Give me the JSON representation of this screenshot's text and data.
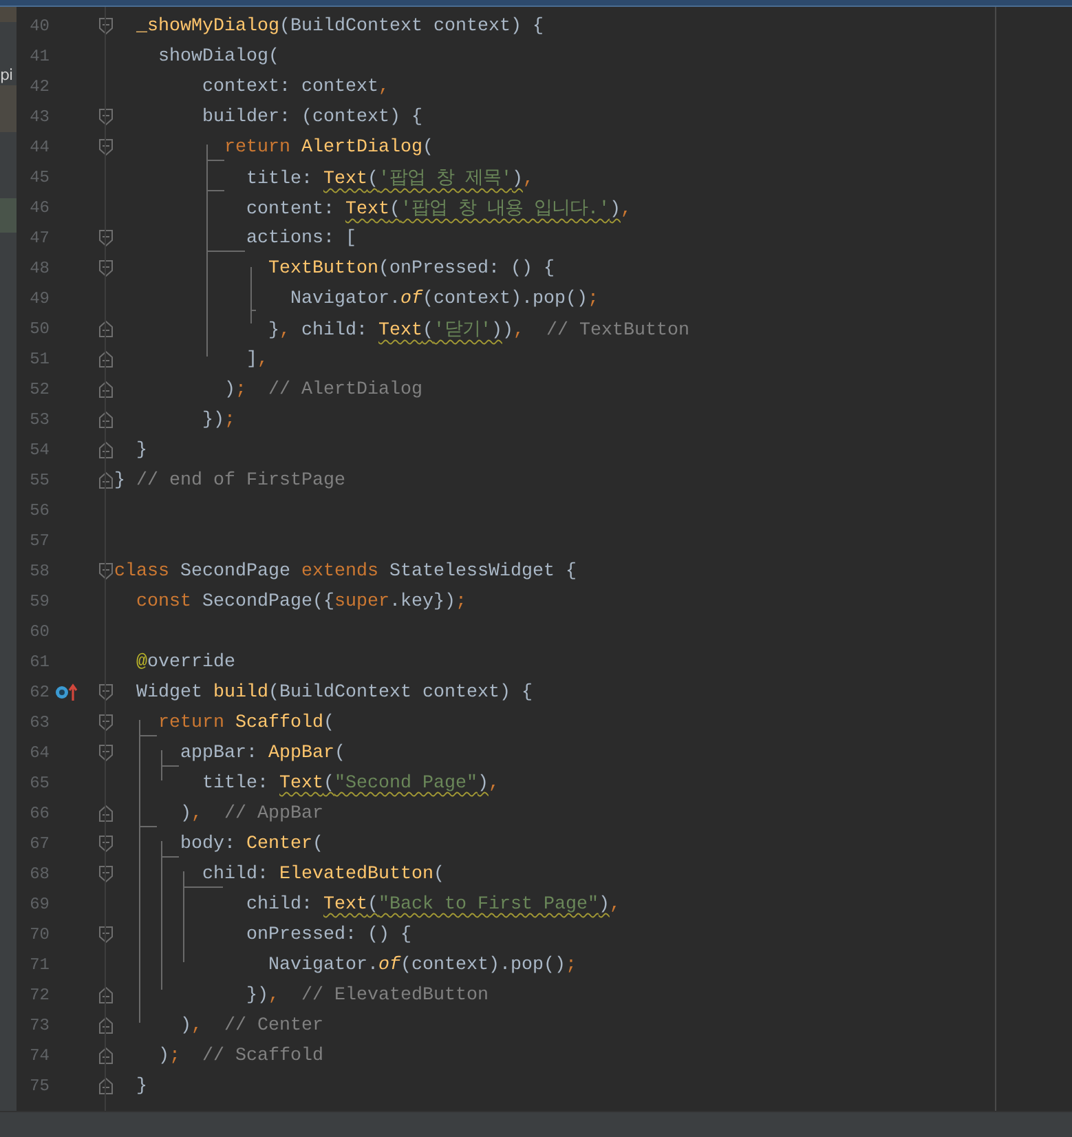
{
  "project_panel": {
    "fragment": "pi"
  },
  "editor": {
    "lines": [
      {
        "number": "40",
        "fold_start": true,
        "fold_end": false,
        "tokens": [
          {
            "text": "  _showMyDialog",
            "kind": "call"
          },
          {
            "text": "(BuildContext context) {",
            "kind": "plain"
          }
        ]
      },
      {
        "number": "41",
        "fold_start": false,
        "fold_end": false,
        "tokens": [
          {
            "text": "    showDialog(",
            "kind": "plain"
          }
        ]
      },
      {
        "number": "42",
        "fold_start": false,
        "fold_end": false,
        "tokens": [
          {
            "text": "        context: context",
            "kind": "plain"
          },
          {
            "text": ",",
            "kind": "punct"
          }
        ]
      },
      {
        "number": "43",
        "fold_start": true,
        "fold_end": false,
        "tokens": [
          {
            "text": "        builder: (context) {",
            "kind": "plain"
          }
        ]
      },
      {
        "number": "44",
        "fold_start": true,
        "fold_end": false,
        "tokens": [
          {
            "text": "          return",
            "kind": "kw"
          },
          {
            "text": " AlertDialog",
            "kind": "call"
          },
          {
            "text": "(",
            "kind": "plain"
          }
        ]
      },
      {
        "number": "45",
        "fold_start": false,
        "fold_end": false,
        "tokens": [
          {
            "text": "            title: ",
            "kind": "plain"
          },
          {
            "text": "Text",
            "kind": "call",
            "warn": true
          },
          {
            "text": "(",
            "kind": "plain",
            "warn": true
          },
          {
            "text": "'팝업 창 제목'",
            "kind": "str",
            "warn": true
          },
          {
            "text": ")",
            "kind": "plain",
            "warn": true
          },
          {
            "text": ",",
            "kind": "punct"
          }
        ]
      },
      {
        "number": "46",
        "fold_start": false,
        "fold_end": false,
        "tokens": [
          {
            "text": "            content: ",
            "kind": "plain"
          },
          {
            "text": "Text",
            "kind": "call",
            "warn": true
          },
          {
            "text": "(",
            "kind": "plain",
            "warn": true
          },
          {
            "text": "'팝업 창 내용 입니다.'",
            "kind": "str",
            "warn": true
          },
          {
            "text": ")",
            "kind": "plain",
            "warn": true
          },
          {
            "text": ",",
            "kind": "punct"
          }
        ]
      },
      {
        "number": "47",
        "fold_start": true,
        "fold_end": false,
        "tokens": [
          {
            "text": "            actions: [",
            "kind": "plain"
          }
        ]
      },
      {
        "number": "48",
        "fold_start": true,
        "fold_end": false,
        "tokens": [
          {
            "text": "              TextButton",
            "kind": "call"
          },
          {
            "text": "(onPressed: () {",
            "kind": "plain"
          }
        ]
      },
      {
        "number": "49",
        "fold_start": false,
        "fold_end": false,
        "tokens": [
          {
            "text": "                Navigator.",
            "kind": "plain"
          },
          {
            "text": "of",
            "kind": "italic"
          },
          {
            "text": "(context).pop()",
            "kind": "plain"
          },
          {
            "text": ";",
            "kind": "punct"
          }
        ]
      },
      {
        "number": "50",
        "fold_start": false,
        "fold_end": true,
        "tokens": [
          {
            "text": "              }",
            "kind": "plain"
          },
          {
            "text": ",",
            "kind": "punct"
          },
          {
            "text": " child: ",
            "kind": "plain"
          },
          {
            "text": "Text",
            "kind": "call",
            "warn": true
          },
          {
            "text": "(",
            "kind": "plain",
            "warn": true
          },
          {
            "text": "'닫기'",
            "kind": "str",
            "warn": true
          },
          {
            "text": ")",
            "kind": "plain",
            "warn": true
          },
          {
            "text": ")",
            "kind": "plain"
          },
          {
            "text": ",",
            "kind": "punct"
          },
          {
            "text": "  // TextButton",
            "kind": "cmt"
          }
        ]
      },
      {
        "number": "51",
        "fold_start": false,
        "fold_end": true,
        "tokens": [
          {
            "text": "            ]",
            "kind": "plain"
          },
          {
            "text": ",",
            "kind": "punct"
          }
        ]
      },
      {
        "number": "52",
        "fold_start": false,
        "fold_end": true,
        "tokens": [
          {
            "text": "          )",
            "kind": "plain"
          },
          {
            "text": ";",
            "kind": "punct"
          },
          {
            "text": "  // AlertDialog",
            "kind": "cmt"
          }
        ]
      },
      {
        "number": "53",
        "fold_start": false,
        "fold_end": true,
        "tokens": [
          {
            "text": "        })",
            "kind": "plain"
          },
          {
            "text": ";",
            "kind": "punct"
          }
        ]
      },
      {
        "number": "54",
        "fold_start": false,
        "fold_end": true,
        "tokens": [
          {
            "text": "  }",
            "kind": "plain"
          }
        ]
      },
      {
        "number": "55",
        "fold_start": false,
        "fold_end": true,
        "tokens": [
          {
            "text": "}",
            "kind": "plain"
          },
          {
            "text": " // end of FirstPage",
            "kind": "cmt"
          }
        ]
      },
      {
        "number": "56",
        "fold_start": false,
        "fold_end": false
      },
      {
        "number": "57",
        "fold_start": false,
        "fold_end": false
      },
      {
        "number": "58",
        "fold_start": true,
        "fold_end": false,
        "tokens": [
          {
            "text": "class",
            "kind": "kw"
          },
          {
            "text": " SecondPage ",
            "kind": "plain"
          },
          {
            "text": "extends",
            "kind": "kw"
          },
          {
            "text": " StatelessWidget {",
            "kind": "plain"
          }
        ]
      },
      {
        "number": "59",
        "fold_start": false,
        "fold_end": false,
        "tokens": [
          {
            "text": "  const",
            "kind": "kw"
          },
          {
            "text": " SecondPage({",
            "kind": "plain"
          },
          {
            "text": "super",
            "kind": "kw"
          },
          {
            "text": ".key})",
            "kind": "plain"
          },
          {
            "text": ";",
            "kind": "punct"
          }
        ]
      },
      {
        "number": "60",
        "fold_start": false,
        "fold_end": false
      },
      {
        "number": "61",
        "fold_start": false,
        "fold_end": false,
        "tokens": [
          {
            "text": "  @",
            "kind": "annot"
          },
          {
            "text": "override",
            "kind": "plain"
          }
        ]
      },
      {
        "number": "62",
        "fold_start": true,
        "fold_end": false,
        "override_marker": true,
        "tokens": [
          {
            "text": "  Widget ",
            "kind": "plain"
          },
          {
            "text": "build",
            "kind": "call"
          },
          {
            "text": "(BuildContext context) {",
            "kind": "plain"
          }
        ]
      },
      {
        "number": "63",
        "fold_start": true,
        "fold_end": false,
        "tokens": [
          {
            "text": "    return",
            "kind": "kw"
          },
          {
            "text": " Scaffold",
            "kind": "call"
          },
          {
            "text": "(",
            "kind": "plain"
          }
        ]
      },
      {
        "number": "64",
        "fold_start": true,
        "fold_end": false,
        "tokens": [
          {
            "text": "      appBar: ",
            "kind": "plain"
          },
          {
            "text": "AppBar",
            "kind": "call"
          },
          {
            "text": "(",
            "kind": "plain"
          }
        ]
      },
      {
        "number": "65",
        "fold_start": false,
        "fold_end": false,
        "tokens": [
          {
            "text": "        title: ",
            "kind": "plain"
          },
          {
            "text": "Text",
            "kind": "call",
            "warn": true
          },
          {
            "text": "(",
            "kind": "plain",
            "warn": true
          },
          {
            "text": "\"Second Page\"",
            "kind": "str",
            "warn": true
          },
          {
            "text": ")",
            "kind": "plain",
            "warn": true
          },
          {
            "text": ",",
            "kind": "punct"
          }
        ]
      },
      {
        "number": "66",
        "fold_start": false,
        "fold_end": true,
        "tokens": [
          {
            "text": "      )",
            "kind": "plain"
          },
          {
            "text": ",",
            "kind": "punct"
          },
          {
            "text": "  // AppBar",
            "kind": "cmt"
          }
        ]
      },
      {
        "number": "67",
        "fold_start": true,
        "fold_end": false,
        "tokens": [
          {
            "text": "      body: ",
            "kind": "plain"
          },
          {
            "text": "Center",
            "kind": "call"
          },
          {
            "text": "(",
            "kind": "plain"
          }
        ]
      },
      {
        "number": "68",
        "fold_start": true,
        "fold_end": false,
        "tokens": [
          {
            "text": "        child: ",
            "kind": "plain"
          },
          {
            "text": "ElevatedButton",
            "kind": "call"
          },
          {
            "text": "(",
            "kind": "plain"
          }
        ]
      },
      {
        "number": "69",
        "fold_start": false,
        "fold_end": false,
        "tokens": [
          {
            "text": "            child: ",
            "kind": "plain"
          },
          {
            "text": "Text",
            "kind": "call",
            "warn": true
          },
          {
            "text": "(",
            "kind": "plain",
            "warn": true
          },
          {
            "text": "\"Back to First Page\"",
            "kind": "str",
            "warn": true
          },
          {
            "text": ")",
            "kind": "plain",
            "warn": true
          },
          {
            "text": ",",
            "kind": "punct"
          }
        ]
      },
      {
        "number": "70",
        "fold_start": true,
        "fold_end": false,
        "tokens": [
          {
            "text": "            onPressed: () {",
            "kind": "plain"
          }
        ]
      },
      {
        "number": "71",
        "fold_start": false,
        "fold_end": false,
        "tokens": [
          {
            "text": "              Navigator.",
            "kind": "plain"
          },
          {
            "text": "of",
            "kind": "italic"
          },
          {
            "text": "(context).pop()",
            "kind": "plain"
          },
          {
            "text": ";",
            "kind": "punct"
          }
        ]
      },
      {
        "number": "72",
        "fold_start": false,
        "fold_end": true,
        "tokens": [
          {
            "text": "            })",
            "kind": "plain"
          },
          {
            "text": ",",
            "kind": "punct"
          },
          {
            "text": "  // ElevatedButton",
            "kind": "cmt"
          }
        ]
      },
      {
        "number": "73",
        "fold_start": false,
        "fold_end": true,
        "tokens": [
          {
            "text": "      )",
            "kind": "plain"
          },
          {
            "text": ",",
            "kind": "punct"
          },
          {
            "text": "  // Center",
            "kind": "cmt"
          }
        ]
      },
      {
        "number": "74",
        "fold_start": false,
        "fold_end": true,
        "tokens": [
          {
            "text": "    )",
            "kind": "plain"
          },
          {
            "text": ";",
            "kind": "punct"
          },
          {
            "text": "  // Scaffold",
            "kind": "cmt"
          }
        ]
      },
      {
        "number": "75",
        "fold_start": false,
        "fold_end": true,
        "tokens": [
          {
            "text": "  }",
            "kind": "plain"
          }
        ]
      }
    ]
  }
}
